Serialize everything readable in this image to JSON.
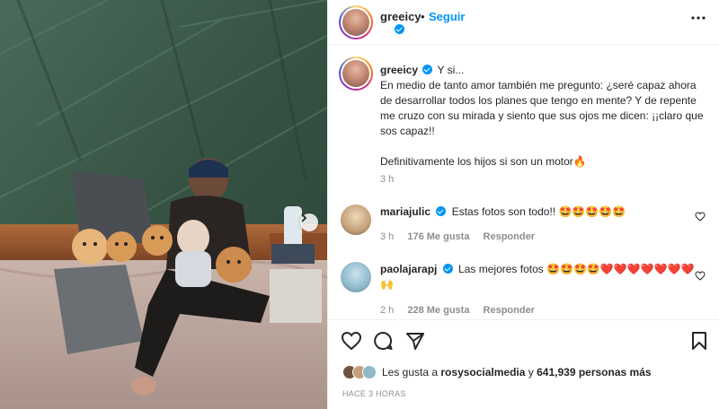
{
  "post": {
    "author": "greeicy",
    "follow_label": "Seguir",
    "header_dot": "•",
    "more_label": "•••",
    "caption_user": "greeicy",
    "caption_text": "Y si...\nEn medio de tanto amor también me pregunto: ¿seré capaz ahora de desarrollar todos los planes que tengo en mente? Y de repente me cruzo con su mirada y siento que sus ojos me dicen: ¡¡claro que sos capaz!!\n\nDefinitivamente los hijos si son un motor🔥",
    "caption_time": "3 h"
  },
  "comments": [
    {
      "user": "mariajulic",
      "text": "Estas fotos son todo!! 🤩🤩🤩🤩🤩",
      "time": "3 h",
      "likes": "176 Me gusta",
      "reply": "Responder"
    },
    {
      "user": "paolajarapj",
      "text": "Las mejores fotos 🤩🤩🤩🤩❤️❤️❤️❤️❤️❤️❤️🙌",
      "time": "2 h",
      "likes": "228 Me gusta",
      "reply": "Responder"
    }
  ],
  "likes": {
    "prefix": "Les gusta a ",
    "first_user": "rosysocialmedia",
    "middle": " y ",
    "others": "641,939 personas más"
  },
  "posted_ago": "HACE 3 HORAS",
  "icons": {
    "like": "heart-icon",
    "comment": "comment-icon",
    "share": "share-icon",
    "save": "bookmark-icon",
    "next": "chevron-right-icon",
    "more": "more-icon"
  },
  "colors": {
    "accent": "#0095f6",
    "muted": "#8e8e8e",
    "text": "#262626"
  }
}
